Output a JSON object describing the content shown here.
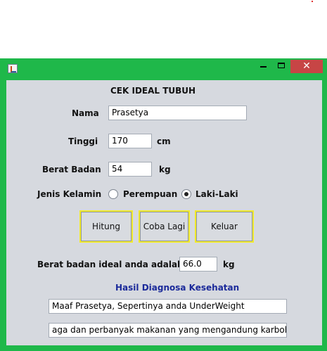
{
  "window": {
    "close_symbol": "✕",
    "minimize_symbol": "",
    "maximize_symbol": ""
  },
  "form": {
    "title": "CEK IDEAL TUBUH",
    "nama_label": "Nama",
    "nama_value": "Prasetya",
    "tinggi_label": "Tinggi",
    "tinggi_value": "170",
    "tinggi_unit": "cm",
    "berat_label": "Berat Badan",
    "berat_value": "54",
    "berat_unit": "kg",
    "gender_label": "Jenis Kelamin",
    "gender_options": [
      "Perempuan",
      "Laki-Laki"
    ],
    "gender_selected": "Laki-Laki"
  },
  "buttons": {
    "hitung": "Hitung",
    "coba_lagi": "Coba Lagi",
    "keluar": "Keluar"
  },
  "result": {
    "ideal_label": "Berat badan ideal anda adalah",
    "ideal_value": "66.0",
    "ideal_unit": "kg",
    "diagnosa_title": "Hasil Diagnosa Kesehatan",
    "diagnosa_line1": "Maaf Prasetya, Sepertinya anda UnderWeight",
    "diagnosa_line2": "aga dan perbanyak makanan yang mengandung karbohidrat"
  },
  "colors": {
    "window_frame": "#1fb84a",
    "close_button": "#c74545",
    "panel": "#d6d9df",
    "button_border": "#f1ea2a",
    "title_blue": "#1b2a9a"
  },
  "icons": [
    "java-app-icon",
    "minimize-icon",
    "maximize-icon",
    "close-icon",
    "radio-icon"
  ]
}
